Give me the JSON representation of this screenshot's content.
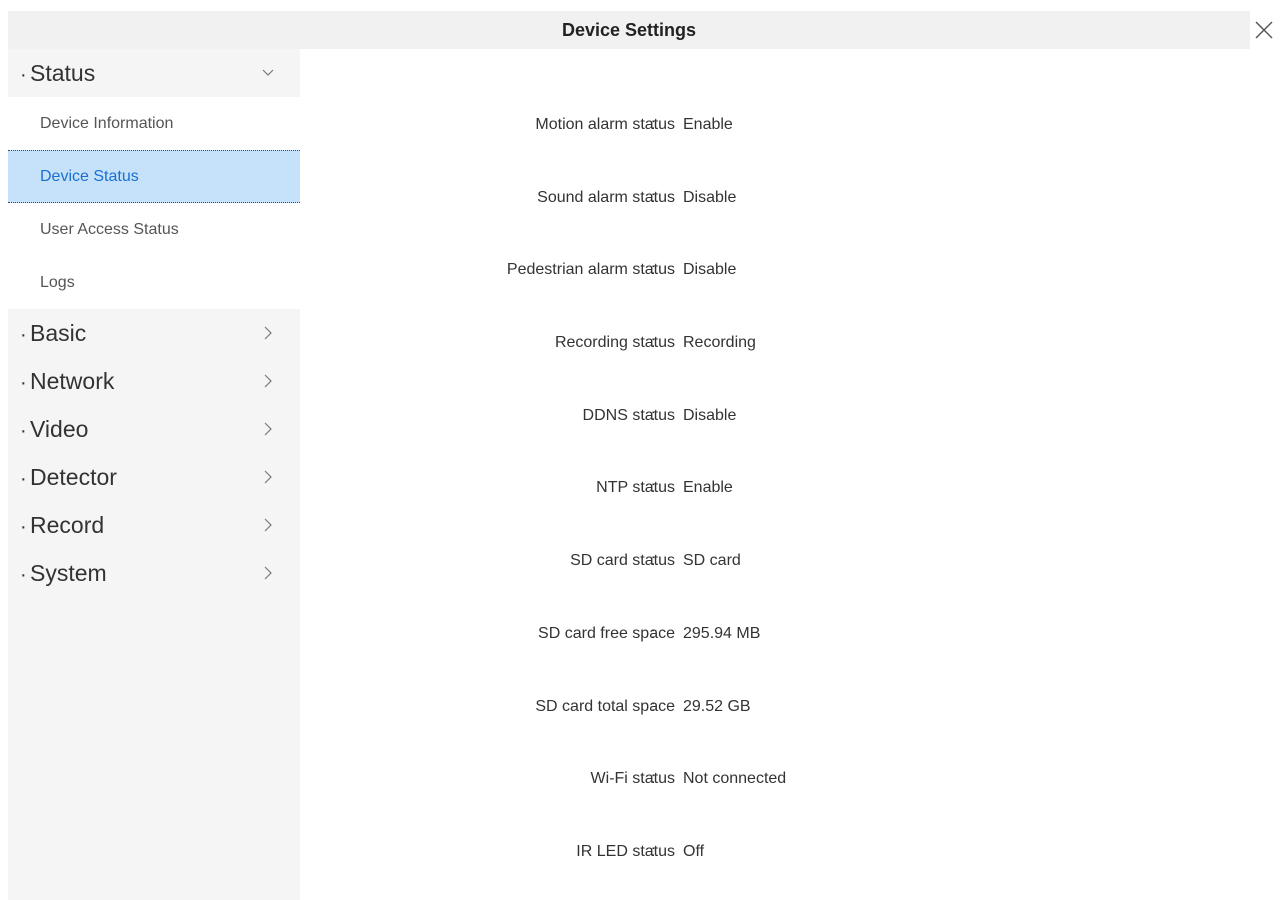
{
  "window": {
    "title": "Device Settings",
    "close_icon": "close-icon"
  },
  "sidebar": {
    "groups": [
      {
        "label": "Status",
        "expanded": true,
        "items": [
          {
            "label": "Device Information",
            "active": false
          },
          {
            "label": "Device Status",
            "active": true
          },
          {
            "label": "User Access Status",
            "active": false
          },
          {
            "label": "Logs",
            "active": false
          }
        ]
      },
      {
        "label": "Basic",
        "expanded": false
      },
      {
        "label": "Network",
        "expanded": false
      },
      {
        "label": "Video",
        "expanded": false
      },
      {
        "label": "Detector",
        "expanded": false
      },
      {
        "label": "Record",
        "expanded": false
      },
      {
        "label": "System",
        "expanded": false
      }
    ],
    "bullet": "·"
  },
  "status": {
    "separator": ":",
    "rows": [
      {
        "label": "Motion alarm status",
        "value": "Enable"
      },
      {
        "label": "Sound alarm status",
        "value": "Disable"
      },
      {
        "label": "Pedestrian alarm status",
        "value": "Disable"
      },
      {
        "label": "Recording status",
        "value": "Recording"
      },
      {
        "label": "DDNS status",
        "value": "Disable"
      },
      {
        "label": "NTP status",
        "value": "Enable"
      },
      {
        "label": "SD card status",
        "value": "SD card"
      },
      {
        "label": "SD card free space",
        "value": "295.94 MB"
      },
      {
        "label": "SD card total space",
        "value": "29.52 GB"
      },
      {
        "label": "Wi-Fi status",
        "value": "Not connected"
      },
      {
        "label": "IR LED status",
        "value": "Off"
      }
    ]
  },
  "colors": {
    "active_bg": "#c6e2fb",
    "active_text": "#1a6fd1",
    "sidebar_bg": "#f5f5f5",
    "title_bg": "#f1f1f1"
  }
}
